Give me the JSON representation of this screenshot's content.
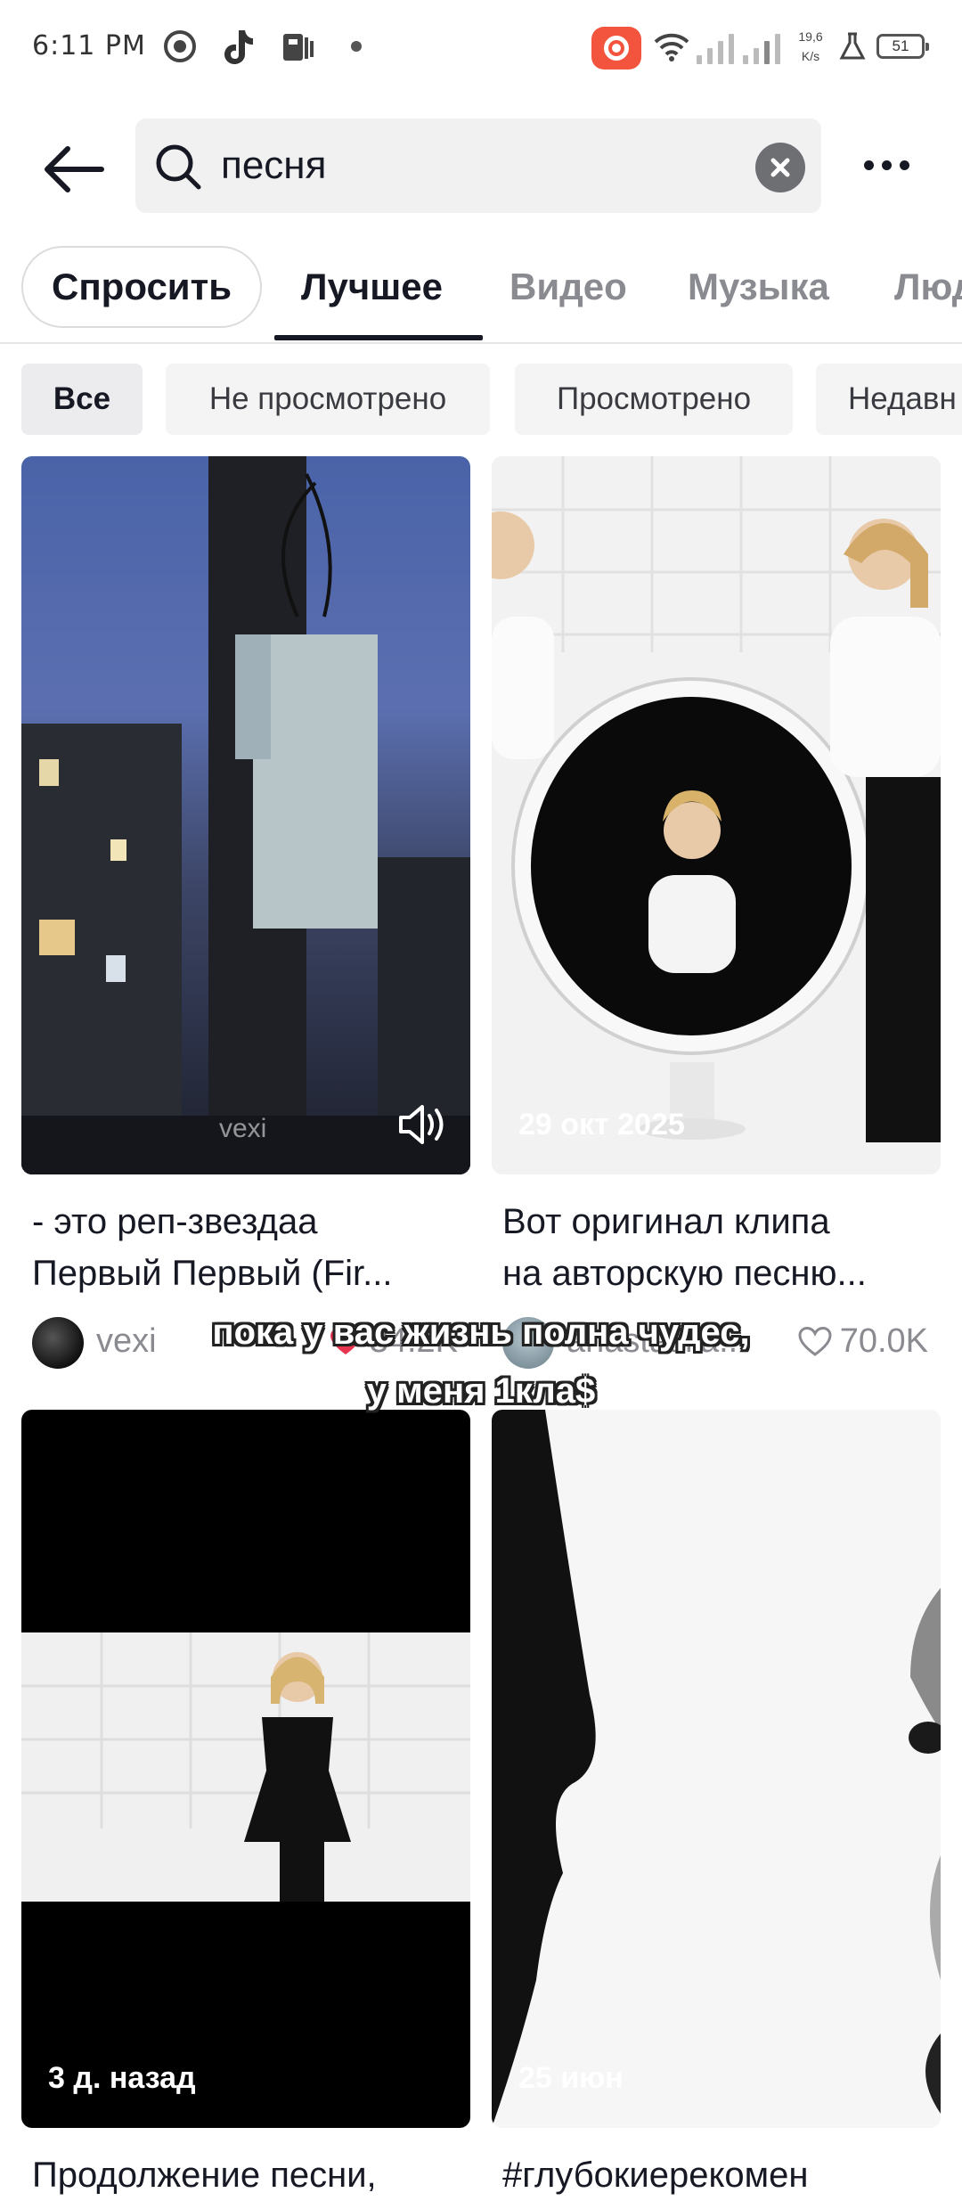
{
  "status_bar": {
    "time": "6:11 PM",
    "net_speed_value": "19,6",
    "net_speed_unit": "K/s",
    "battery": "51",
    "accent_color": "#f2543d"
  },
  "search": {
    "query": "песня",
    "clear_icon": "close-icon",
    "search_icon": "search-icon"
  },
  "tabs": {
    "ask": "Спросить",
    "items": [
      "Лучшее",
      "Видео",
      "Музыка",
      "Люд"
    ],
    "active": "Лучшее"
  },
  "filters": {
    "items": [
      "Все",
      "Не просмотрено",
      "Просмотрено",
      "Недавн"
    ],
    "active": "Все"
  },
  "cards": [
    {
      "watermark": "vexi",
      "title_line1": "- это реп-звездаа",
      "title_line2": "Первый Первый (Fir...",
      "username": "vexi",
      "likes": "34.2K",
      "sound_icon": "speaker-icon"
    },
    {
      "date": "29 окт 2025",
      "title_line1": "Вот оригинал клипа",
      "title_line2": "на авторскую песню...",
      "username": "anastasiia...",
      "likes": "70.0K"
    },
    {
      "date": "3 д. назад",
      "title_line1": "Продолжение песни,"
    },
    {
      "date": "25 июн",
      "title_line1": "#глубокиерекомен"
    }
  ],
  "overlay_caption": {
    "line1": "пока у вас жизнь полна чудес,",
    "line2": "у меня 1кла$"
  }
}
